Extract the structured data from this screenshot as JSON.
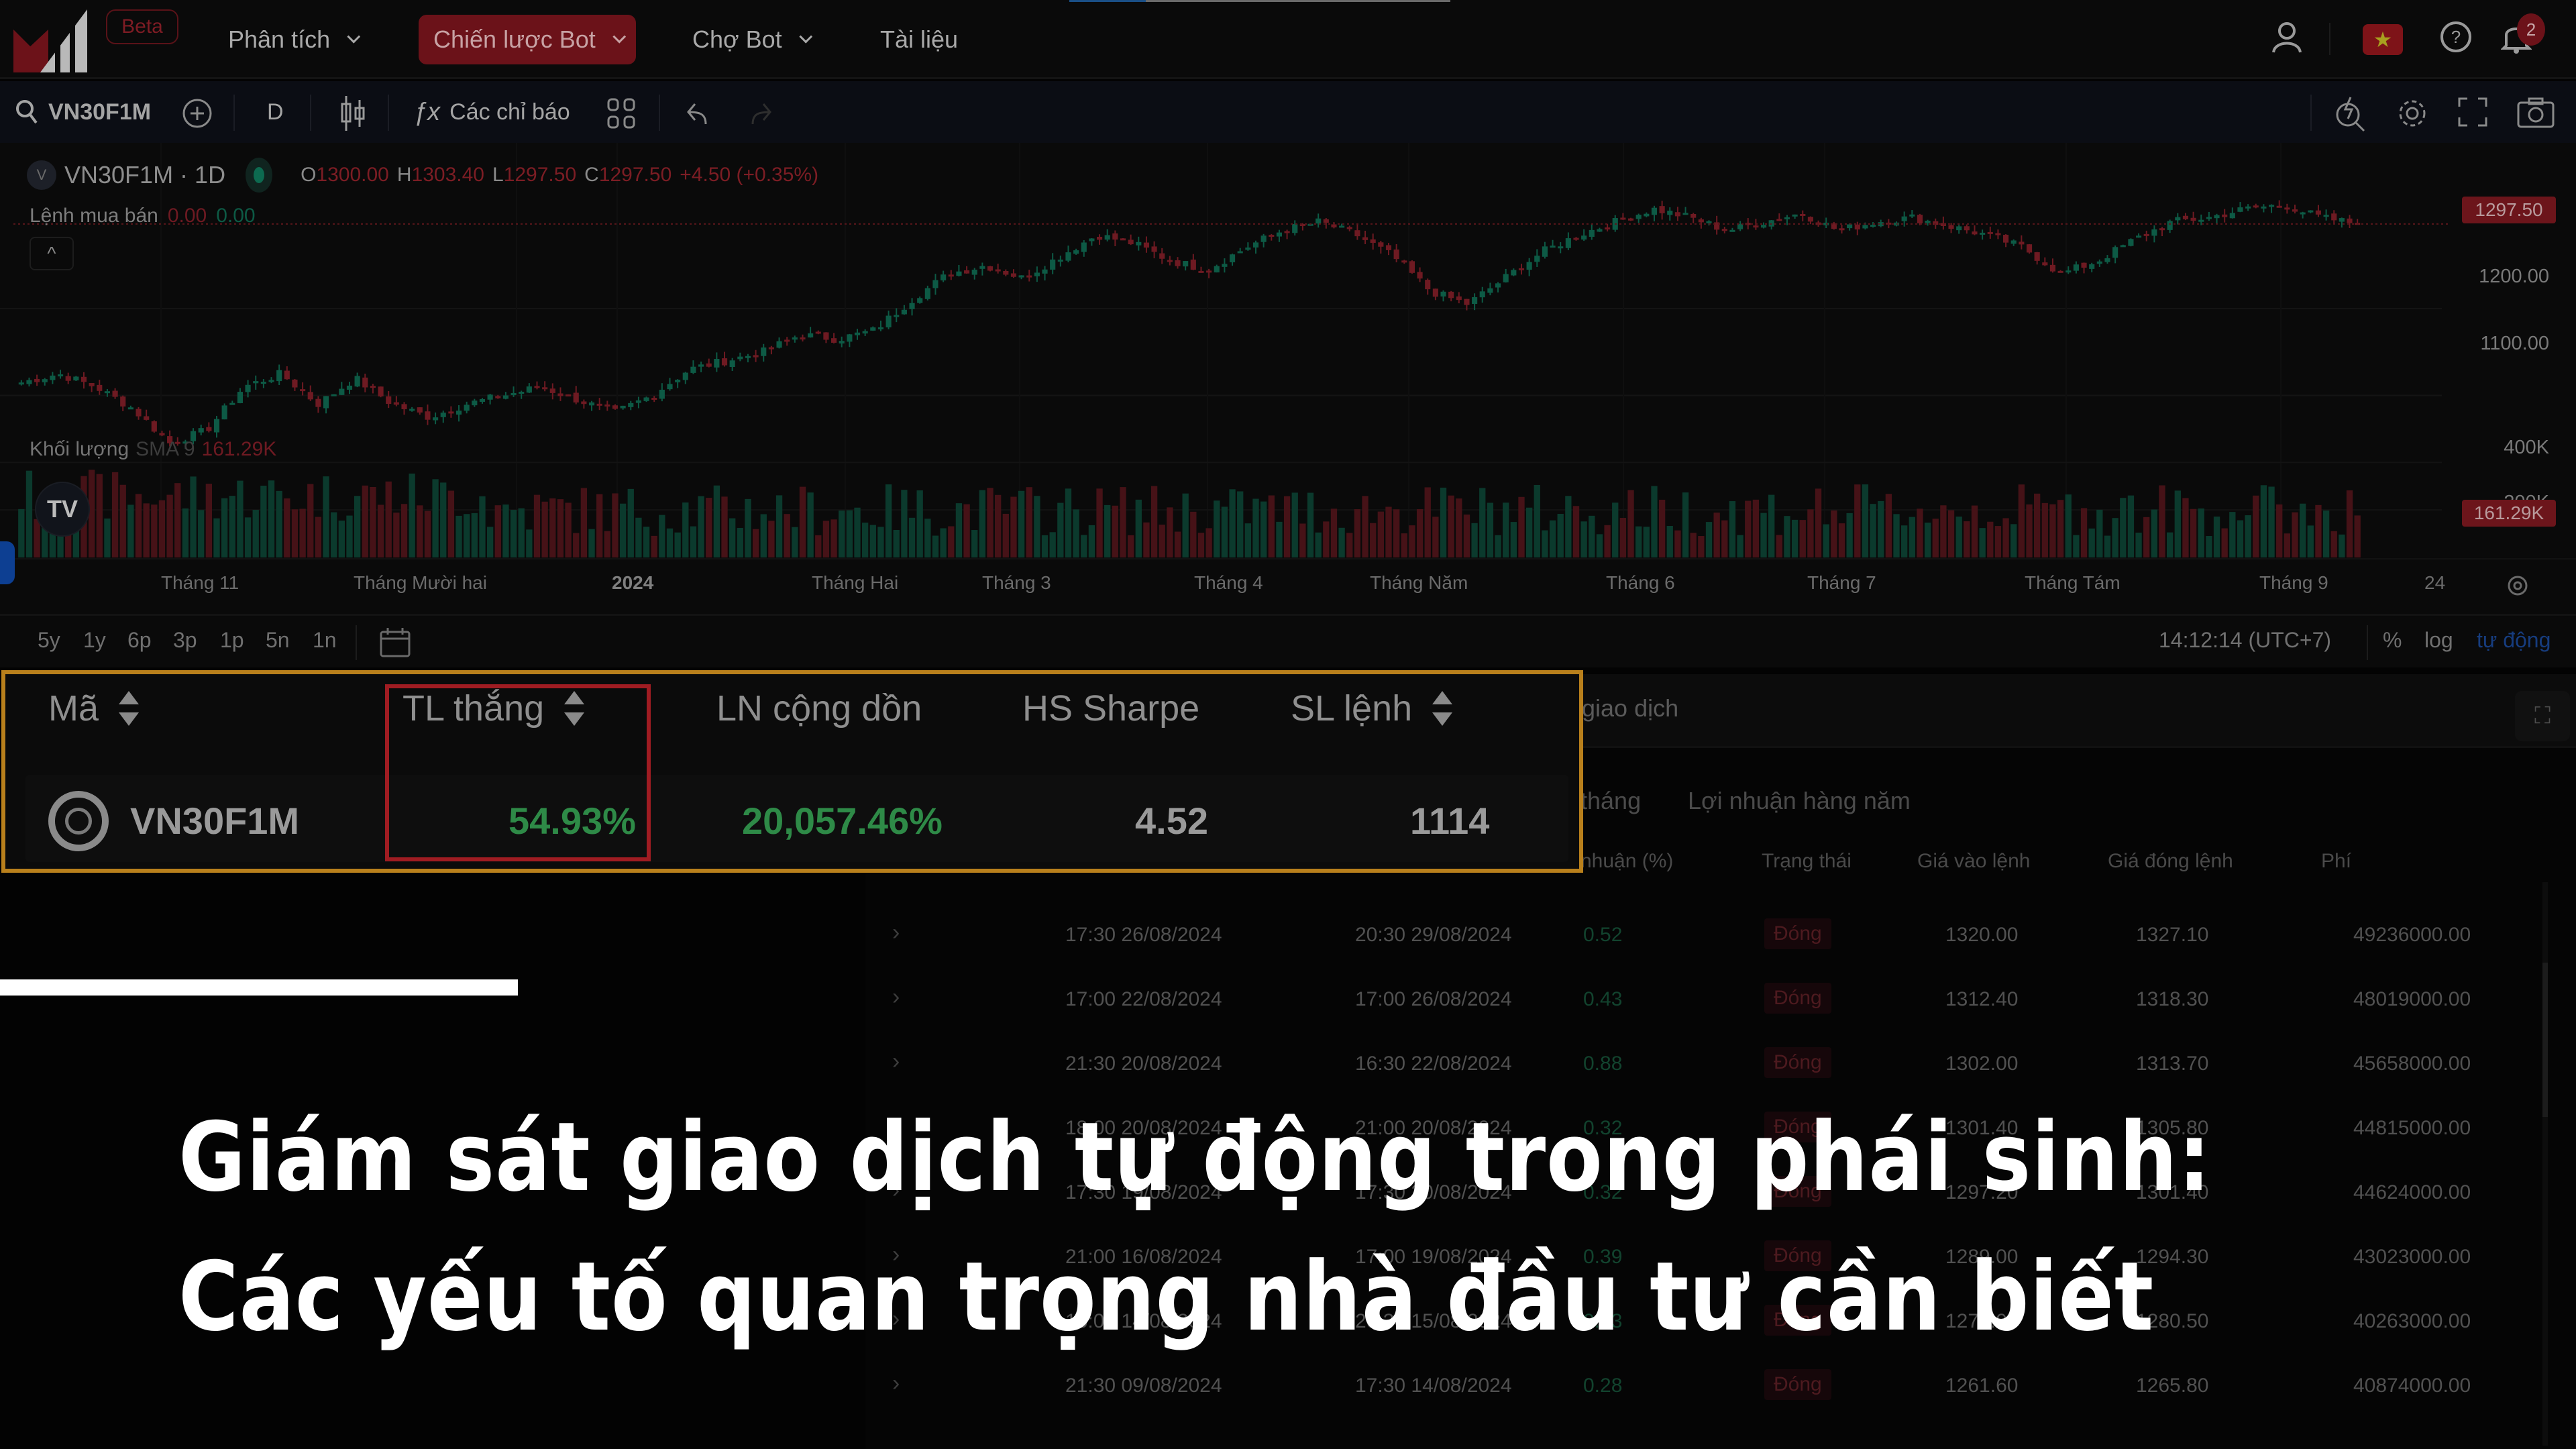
{
  "nav": {
    "beta_label": "Beta",
    "items": [
      {
        "label": "Phân tích",
        "has_dropdown": true,
        "active": false
      },
      {
        "label": "Chiến lược Bot",
        "has_dropdown": true,
        "active": true
      },
      {
        "label": "Chợ Bot",
        "has_dropdown": true,
        "active": false
      },
      {
        "label": "Tài liệu",
        "has_dropdown": false,
        "active": false
      }
    ],
    "icons": [
      "user-icon",
      "vietnam-flag-icon",
      "help-icon",
      "bell-icon"
    ],
    "notification_count": "2",
    "page_load_progress": 0.2
  },
  "toolbar": {
    "symbol": "VN30F1M",
    "interval": "D",
    "indicators_label": "Các chỉ báo",
    "icons": [
      "search-icon",
      "add-symbol-icon",
      "candle-style-icon",
      "fx-icon",
      "layouts-icon",
      "undo-icon",
      "redo-icon",
      "quick-search-icon",
      "settings-icon",
      "fullscreen-icon",
      "camera-icon"
    ]
  },
  "chart": {
    "title": "VN30F1M · 1D",
    "symbol_initial": "V",
    "ohlc": {
      "o_label": "O",
      "o": "1300.00",
      "h_label": "H",
      "h": "1303.40",
      "l_label": "L",
      "l": "1297.50",
      "c_label": "C",
      "c": "1297.50",
      "change": "+4.50 (+0.35%)"
    },
    "orders_label": "Lệnh mua bán",
    "orders_sell": "0.00",
    "orders_buy": "0.00",
    "collapse_label": "^",
    "price_axis": [
      "1200.00",
      "1100.00"
    ],
    "last_price": "1297.50",
    "volume_label": "Khối lượng",
    "volume_sma": "SMA 9",
    "volume_sma_value": "161.29K",
    "volume_axis": [
      "400K",
      "200K"
    ],
    "last_volume": "161.29K",
    "tv_logo": "TV",
    "time_axis": [
      "Tháng 11",
      "Tháng Mười hai",
      "2024",
      "Tháng Hai",
      "Tháng 3",
      "Tháng 4",
      "Tháng Năm",
      "Tháng 6",
      "Tháng 7",
      "Tháng Tám",
      "Tháng 9",
      "24"
    ],
    "colors": {
      "up": "#0d5a45",
      "down": "#6e1a22"
    }
  },
  "chart_data": {
    "type": "candlestick",
    "title": "VN30F1M · 1D",
    "ylim": [
      1020,
      1360
    ],
    "y_ticks": [
      1100,
      1200
    ],
    "last_close": 1297.5,
    "x_labels": [
      "Tháng 11",
      "Tháng Mười hai",
      "2024",
      "Tháng Hai",
      "Tháng 3",
      "Tháng 4",
      "Tháng Năm",
      "Tháng 6",
      "Tháng 7",
      "Tháng Tám",
      "Tháng 9"
    ],
    "close_path_approx": [
      1115,
      1125,
      1110,
      1085,
      1045,
      1060,
      1110,
      1125,
      1090,
      1120,
      1090,
      1075,
      1090,
      1100,
      1110,
      1095,
      1080,
      1100,
      1130,
      1140,
      1150,
      1170,
      1165,
      1175,
      1210,
      1240,
      1250,
      1235,
      1260,
      1285,
      1275,
      1255,
      1245,
      1270,
      1290,
      1300,
      1285,
      1260,
      1220,
      1205,
      1235,
      1265,
      1285,
      1300,
      1315,
      1305,
      1290,
      1300,
      1310,
      1290,
      1300,
      1305,
      1295,
      1285,
      1270,
      1240,
      1255,
      1280,
      1300,
      1305,
      1315,
      1320,
      1305,
      1297.5
    ],
    "volume_ylim": [
      0,
      460000
    ],
    "volume_y_ticks": [
      200000,
      400000
    ],
    "volume_sma9_last": 161290
  },
  "range_bar": {
    "ranges": [
      "5y",
      "1y",
      "6p",
      "3p",
      "1p",
      "5n",
      "1n"
    ],
    "clock": "14:12:14 (UTC+7)",
    "percent_label": "%",
    "log_label": "log",
    "auto_label": "tự động"
  },
  "metrics_card": {
    "headers": [
      {
        "label": "Mã",
        "sortable": true
      },
      {
        "label": "TL thắng",
        "sortable": true
      },
      {
        "label": "LN cộng dồn",
        "sortable": false
      },
      {
        "label": "HS Sharpe",
        "sortable": false
      },
      {
        "label": "SL lệnh",
        "sortable": true
      }
    ],
    "row": {
      "symbol": "VN30F1M",
      "win_rate": "54.93%",
      "cumulative_profit": "20,057.46%",
      "sharpe": "4.52",
      "order_count": "1114"
    },
    "highlight_color": "#b9801c",
    "focus_color": "#a01c22"
  },
  "trades_panel": {
    "title": "giao dịch",
    "subtabs": [
      "tháng",
      "Lợi nhuận hàng năm"
    ],
    "columns": [
      "nhuận (%)",
      "Trạng thái",
      "Giá vào lệnh",
      "Giá đóng lệnh",
      "Phí"
    ],
    "rows": [
      {
        "open": "17:30 26/08/2024",
        "close": "20:30 29/08/2024",
        "profit": "0.52",
        "status": "Đóng",
        "entry": "1320.00",
        "exit": "1327.10",
        "fee": "49236000.00"
      },
      {
        "open": "17:00 22/08/2024",
        "close": "17:00 26/08/2024",
        "profit": "0.43",
        "status": "Đóng",
        "entry": "1312.40",
        "exit": "1318.30",
        "fee": "48019000.00"
      },
      {
        "open": "21:30 20/08/2024",
        "close": "16:30 22/08/2024",
        "profit": "0.88",
        "status": "Đóng",
        "entry": "1302.00",
        "exit": "1313.70",
        "fee": "45658000.00"
      },
      {
        "open": "18:00 20/08/2024",
        "close": "21:00 20/08/2024",
        "profit": "0.32",
        "status": "Đóng",
        "entry": "1301.40",
        "exit": "1305.80",
        "fee": "44815000.00"
      },
      {
        "open": "17:30 19/08/2024",
        "close": "17:30 20/08/2024",
        "profit": "0.32",
        "status": "Đóng",
        "entry": "1297.20",
        "exit": "1301.40",
        "fee": "44624000.00"
      },
      {
        "open": "21:00 16/08/2024",
        "close": "17:00 19/08/2024",
        "profit": "0.39",
        "status": "Đóng",
        "entry": "1289.00",
        "exit": "1294.30",
        "fee": "43023000.00"
      },
      {
        "open": "18:00 14/08/2024",
        "close": "20:30 15/08/2024",
        "profit": "0.33",
        "status": "Đóng",
        "entry": "1276.00",
        "exit": "1280.50",
        "fee": "40263000.00"
      },
      {
        "open": "21:30 09/08/2024",
        "close": "17:30 14/08/2024",
        "profit": "0.28",
        "status": "Đóng",
        "entry": "1261.60",
        "exit": "1265.80",
        "fee": "40874000.00"
      }
    ]
  },
  "headline": {
    "line1": "Giám sát giao dịch tự động trong phái sinh:",
    "line2": "Các yếu tố quan trọng nhà đầu tư cần biết"
  }
}
